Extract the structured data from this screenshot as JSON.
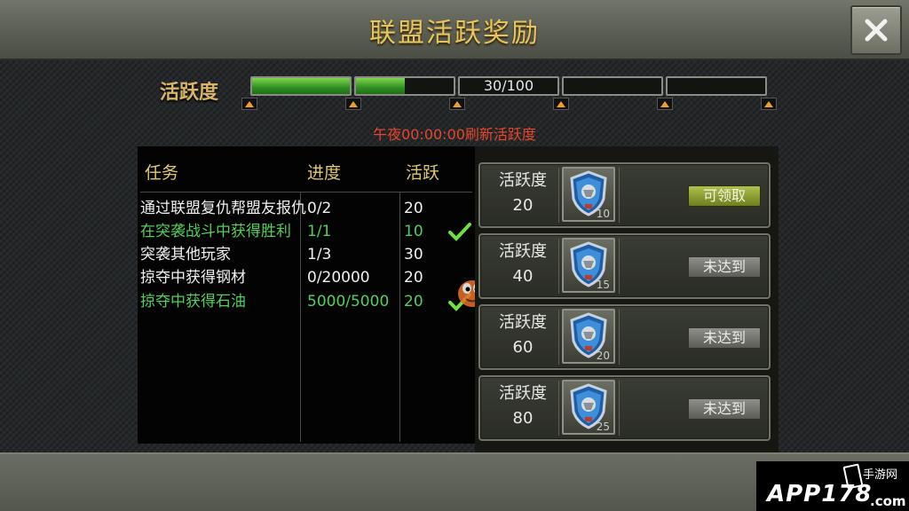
{
  "header": {
    "title": "联盟活跃奖励",
    "close_icon": "close-icon"
  },
  "activity": {
    "label": "活跃度",
    "value": 30,
    "max": 100,
    "progress_text": "30/100",
    "segment_fills": [
      1,
      0.5,
      0,
      0,
      0,
      0
    ],
    "refresh_note": "午夜00:00:00刷新活跃度"
  },
  "tasks": {
    "headers": {
      "task": "任务",
      "progress": "进度",
      "points": "活跃"
    },
    "rows": [
      {
        "name": "通过联盟复仇帮盟友报仇",
        "progress": "0/2",
        "points": "20",
        "done": false
      },
      {
        "name": "在突袭战斗中获得胜利",
        "progress": "1/1",
        "points": "10",
        "done": true
      },
      {
        "name": "突袭其他玩家",
        "progress": "1/3",
        "points": "30",
        "done": false
      },
      {
        "name": "掠夺中获得钢材",
        "progress": "0/20000",
        "points": "20",
        "done": false
      },
      {
        "name": "掠夺中获得石油",
        "progress": "5000/5000",
        "points": "20",
        "done": true
      }
    ]
  },
  "rewards": [
    {
      "caption": "活跃度",
      "required": "20",
      "count": "10",
      "button": "可领取",
      "claimable": true
    },
    {
      "caption": "活跃度",
      "required": "40",
      "count": "15",
      "button": "未达到",
      "claimable": false
    },
    {
      "caption": "活跃度",
      "required": "60",
      "count": "20",
      "button": "未达到",
      "claimable": false
    },
    {
      "caption": "活跃度",
      "required": "80",
      "count": "25",
      "button": "未达到",
      "claimable": false
    }
  ],
  "watermark": {
    "main": "APP178",
    "sub": "手游网",
    "domain": ".com"
  },
  "colors": {
    "gold": "#e9c45b",
    "green": "#52d05a",
    "red": "#e8462a"
  }
}
